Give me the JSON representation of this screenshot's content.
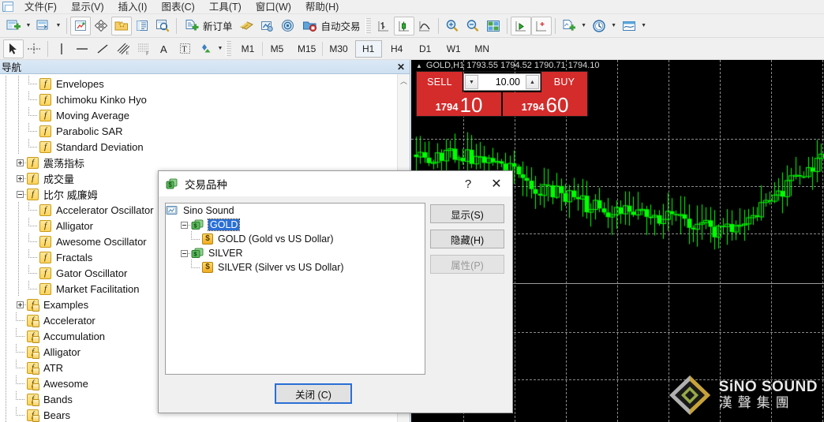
{
  "menubar": {
    "items": [
      {
        "label": "文件(F)"
      },
      {
        "label": "显示(V)"
      },
      {
        "label": "插入(I)"
      },
      {
        "label": "图表(C)"
      },
      {
        "label": "工具(T)"
      },
      {
        "label": "窗口(W)"
      },
      {
        "label": "帮助(H)"
      }
    ]
  },
  "toolbar_main": {
    "new_chart_icon": "new-chart-icon",
    "profiles_icon": "profiles-icon",
    "market_watch_icon": "market-watch-icon",
    "data_window_icon": "data-window-icon",
    "navigator_icon": "navigator-icon",
    "terminal_icon": "terminal-icon",
    "strategy_tester_icon": "strategy-tester-icon",
    "new_order_label": "新订单",
    "metaeditor_icon": "metaeditor-icon",
    "expert_advisors_icon": "expert-advisors-icon",
    "signals_icon": "signals-icon",
    "autotrading_label": "自动交易",
    "bar_chart_icon": "bar-chart-icon",
    "candlestick_chart_icon": "candlestick-chart-icon",
    "line_chart_icon": "line-chart-icon",
    "zoom_in_icon": "zoom-in-icon",
    "zoom_out_icon": "zoom-out-icon",
    "tile_windows_icon": "tile-windows-icon",
    "auto_scroll_icon": "auto-scroll-icon",
    "chart_shift_icon": "chart-shift-icon",
    "indicators_icon": "indicators-icon",
    "periods_icon": "periods-icon",
    "templates_icon": "templates-icon"
  },
  "toolbar_tools": {
    "cursor_icon": "cursor-icon",
    "crosshair_icon": "crosshair-icon",
    "vertical_line_icon": "vertical-line-icon",
    "horizontal_line_icon": "horizontal-line-icon",
    "trendline_icon": "trendline-icon",
    "equidistant_channel_icon": "equidistant-channel-icon",
    "fibonacci_icon": "fibonacci-icon",
    "text_icon": "text-icon",
    "text_label_icon": "text-label-icon",
    "shapes_icon": "shapes-icon"
  },
  "timeframes": {
    "items": [
      "M1",
      "M5",
      "M15",
      "M30",
      "H1",
      "H4",
      "D1",
      "W1",
      "MN"
    ],
    "selected": "H1"
  },
  "navigator": {
    "title": "导航",
    "close_icon": "close-icon",
    "scroll_up_icon": "chevron-up-icon",
    "tree": [
      {
        "label": "Envelopes",
        "depth": 2,
        "type": "leaf",
        "icon": "indicator-icon"
      },
      {
        "label": "Ichimoku Kinko Hyo",
        "depth": 2,
        "type": "leaf",
        "icon": "indicator-icon"
      },
      {
        "label": "Moving Average",
        "depth": 2,
        "type": "leaf",
        "icon": "indicator-icon"
      },
      {
        "label": "Parabolic SAR",
        "depth": 2,
        "type": "leaf",
        "icon": "indicator-icon"
      },
      {
        "label": "Standard Deviation",
        "depth": 2,
        "type": "leaf",
        "icon": "indicator-icon"
      },
      {
        "label": "震荡指标",
        "depth": 1,
        "type": "collapsed",
        "icon": "indicator-icon"
      },
      {
        "label": "成交量",
        "depth": 1,
        "type": "collapsed",
        "icon": "indicator-icon"
      },
      {
        "label": "比尔 威廉姆",
        "depth": 1,
        "type": "expanded",
        "icon": "indicator-icon"
      },
      {
        "label": "Accelerator Oscillator",
        "depth": 2,
        "type": "leaf",
        "icon": "indicator-icon"
      },
      {
        "label": "Alligator",
        "depth": 2,
        "type": "leaf",
        "icon": "indicator-icon"
      },
      {
        "label": "Awesome Oscillator",
        "depth": 2,
        "type": "leaf",
        "icon": "indicator-icon"
      },
      {
        "label": "Fractals",
        "depth": 2,
        "type": "leaf",
        "icon": "indicator-icon"
      },
      {
        "label": "Gator Oscillator",
        "depth": 2,
        "type": "leaf",
        "icon": "indicator-icon"
      },
      {
        "label": "Market Facilitation",
        "depth": 2,
        "type": "leaf",
        "icon": "indicator-icon"
      },
      {
        "label": "Examples",
        "depth": 1,
        "type": "collapsed",
        "icon": "custom-indicator-icon"
      },
      {
        "label": "Accelerator",
        "depth": 1,
        "type": "leaf",
        "icon": "custom-indicator-icon"
      },
      {
        "label": "Accumulation",
        "depth": 1,
        "type": "leaf",
        "icon": "custom-indicator-icon"
      },
      {
        "label": "Alligator",
        "depth": 1,
        "type": "leaf",
        "icon": "custom-indicator-icon"
      },
      {
        "label": "ATR",
        "depth": 1,
        "type": "leaf",
        "icon": "custom-indicator-icon"
      },
      {
        "label": "Awesome",
        "depth": 1,
        "type": "leaf",
        "icon": "custom-indicator-icon"
      },
      {
        "label": "Bands",
        "depth": 1,
        "type": "leaf",
        "icon": "custom-indicator-icon"
      },
      {
        "label": "Bears",
        "depth": 1,
        "type": "leaf",
        "icon": "custom-indicator-icon"
      }
    ]
  },
  "chart": {
    "header": "GOLD,H1  1793.55 1794.52 1790.71 1794.10",
    "symbol": "GOLD",
    "period": "H1",
    "open": "1793.55",
    "high": "1794.52",
    "low": "1790.71",
    "close": "1794.10",
    "collapse_icon": "triangle-up-icon",
    "background_color": "#000000",
    "candle_color": "#00ff00",
    "grid_color": "#8a8a8a"
  },
  "trade_panel": {
    "sell_label": "SELL",
    "buy_label": "BUY",
    "volume": "10.00",
    "volume_down_icon": "triangle-down-icon",
    "volume_up_icon": "triangle-up-icon",
    "sell_price_big": "10",
    "sell_price_small": "1794",
    "buy_price_big": "60",
    "buy_price_small": "1794",
    "panel_color": "#d42b2b"
  },
  "watermark": {
    "english": "SiNO SOUND",
    "chinese": "漢聲集團",
    "logo_icon": "sino-sound-diamond-logo"
  },
  "dialog": {
    "title": "交易品种",
    "title_icon": "symbols-icon",
    "help_label": "?",
    "close_icon": "close-icon",
    "tree": [
      {
        "label": "Sino Sound",
        "depth": 0,
        "icon": "server-icon",
        "type": "root",
        "selected": false
      },
      {
        "label": "GOLD",
        "depth": 1,
        "icon": "folder-icon",
        "type": "expanded",
        "selected": true
      },
      {
        "label": "GOLD  (Gold vs US Dollar)",
        "depth": 2,
        "icon": "dollar-icon",
        "type": "leaf",
        "selected": false
      },
      {
        "label": "SILVER",
        "depth": 1,
        "icon": "folder-icon",
        "type": "expanded",
        "selected": false
      },
      {
        "label": "SILVER  (Silver vs US Dollar)",
        "depth": 2,
        "icon": "dollar-icon",
        "type": "leaf",
        "selected": false
      }
    ],
    "buttons": {
      "show": "显示(S)",
      "hide": "隐藏(H)",
      "properties": "属性(P)",
      "properties_disabled": true,
      "close": "关闭 (C)"
    }
  }
}
